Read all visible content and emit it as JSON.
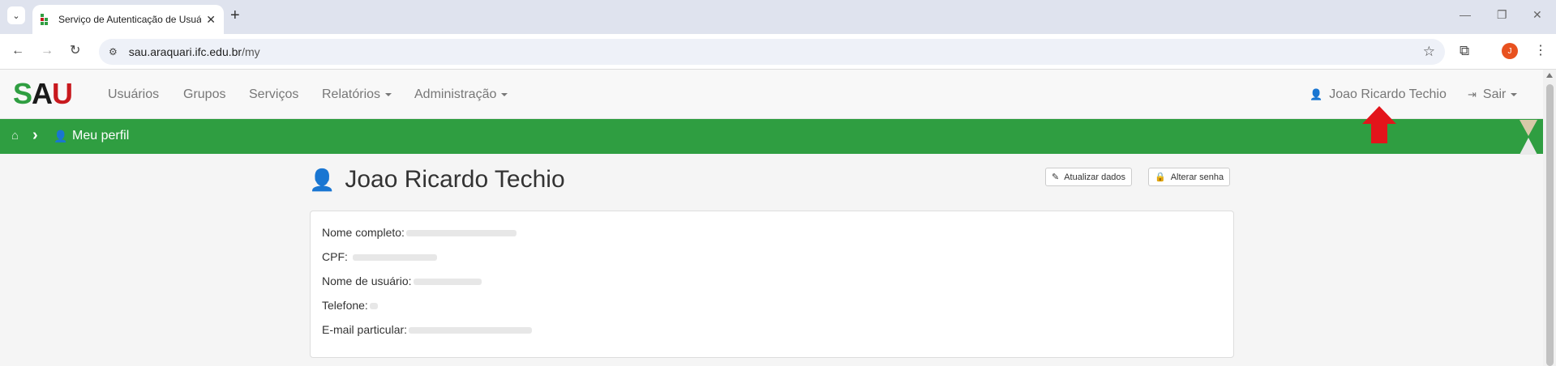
{
  "browser": {
    "tab_title": "Serviço de Autenticação de Usuários",
    "url_host": "sau.araquari.ifc.edu.br",
    "url_path": "/my",
    "profile_initial": "J"
  },
  "brand": {
    "s": "S",
    "a": "A",
    "u": "U"
  },
  "navbar": {
    "usuarios": "Usuários",
    "grupos": "Grupos",
    "servicos": "Serviços",
    "relatorios": "Relatórios",
    "administracao": "Administração",
    "user_name": "Joao Ricardo Techio",
    "sair": "Sair"
  },
  "breadcrumb": {
    "current": "Meu perfil"
  },
  "profile": {
    "name": "Joao Ricardo Techio",
    "btn_update": "Atualizar dados",
    "btn_password": "Alterar senha",
    "fields": [
      {
        "label": "Nome completo:"
      },
      {
        "label": "CPF:"
      },
      {
        "label": "Nome de usuário:"
      },
      {
        "label": "Telefone:"
      },
      {
        "label": "E-mail particular:"
      }
    ]
  },
  "colors": {
    "accent_green": "#2f9e41",
    "brand_red": "#c8191e",
    "annotation_arrow": "#e3141b"
  }
}
